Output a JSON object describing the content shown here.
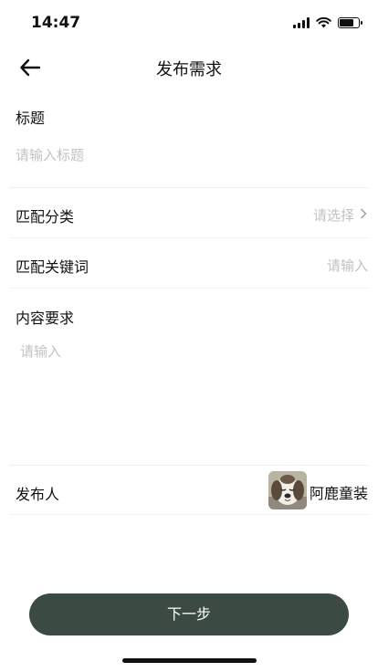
{
  "status_bar": {
    "time": "14:47",
    "signal_icon": "cellular-signal-icon",
    "wifi_icon": "wifi-icon",
    "battery_icon": "battery-icon",
    "battery_level": 0.8
  },
  "nav": {
    "back_icon": "back-arrow-icon",
    "title": "发布需求"
  },
  "form": {
    "title_label": "标题",
    "title_placeholder": "请输入标题",
    "category_label": "匹配分类",
    "category_placeholder": "请选择",
    "category_chevron_icon": "chevron-right-icon",
    "keyword_label": "匹配关键词",
    "keyword_placeholder": "请输入",
    "content_label": "内容要求",
    "content_placeholder": "请输入",
    "publisher_label": "发布人",
    "publisher_name": "阿鹿童装",
    "publisher_avatar_icon": "avatar-image"
  },
  "actions": {
    "next_label": "下一步"
  },
  "colors": {
    "primary_button": "#3b4a43",
    "placeholder": "#c2c2c2",
    "divider": "#f0f0f0"
  }
}
